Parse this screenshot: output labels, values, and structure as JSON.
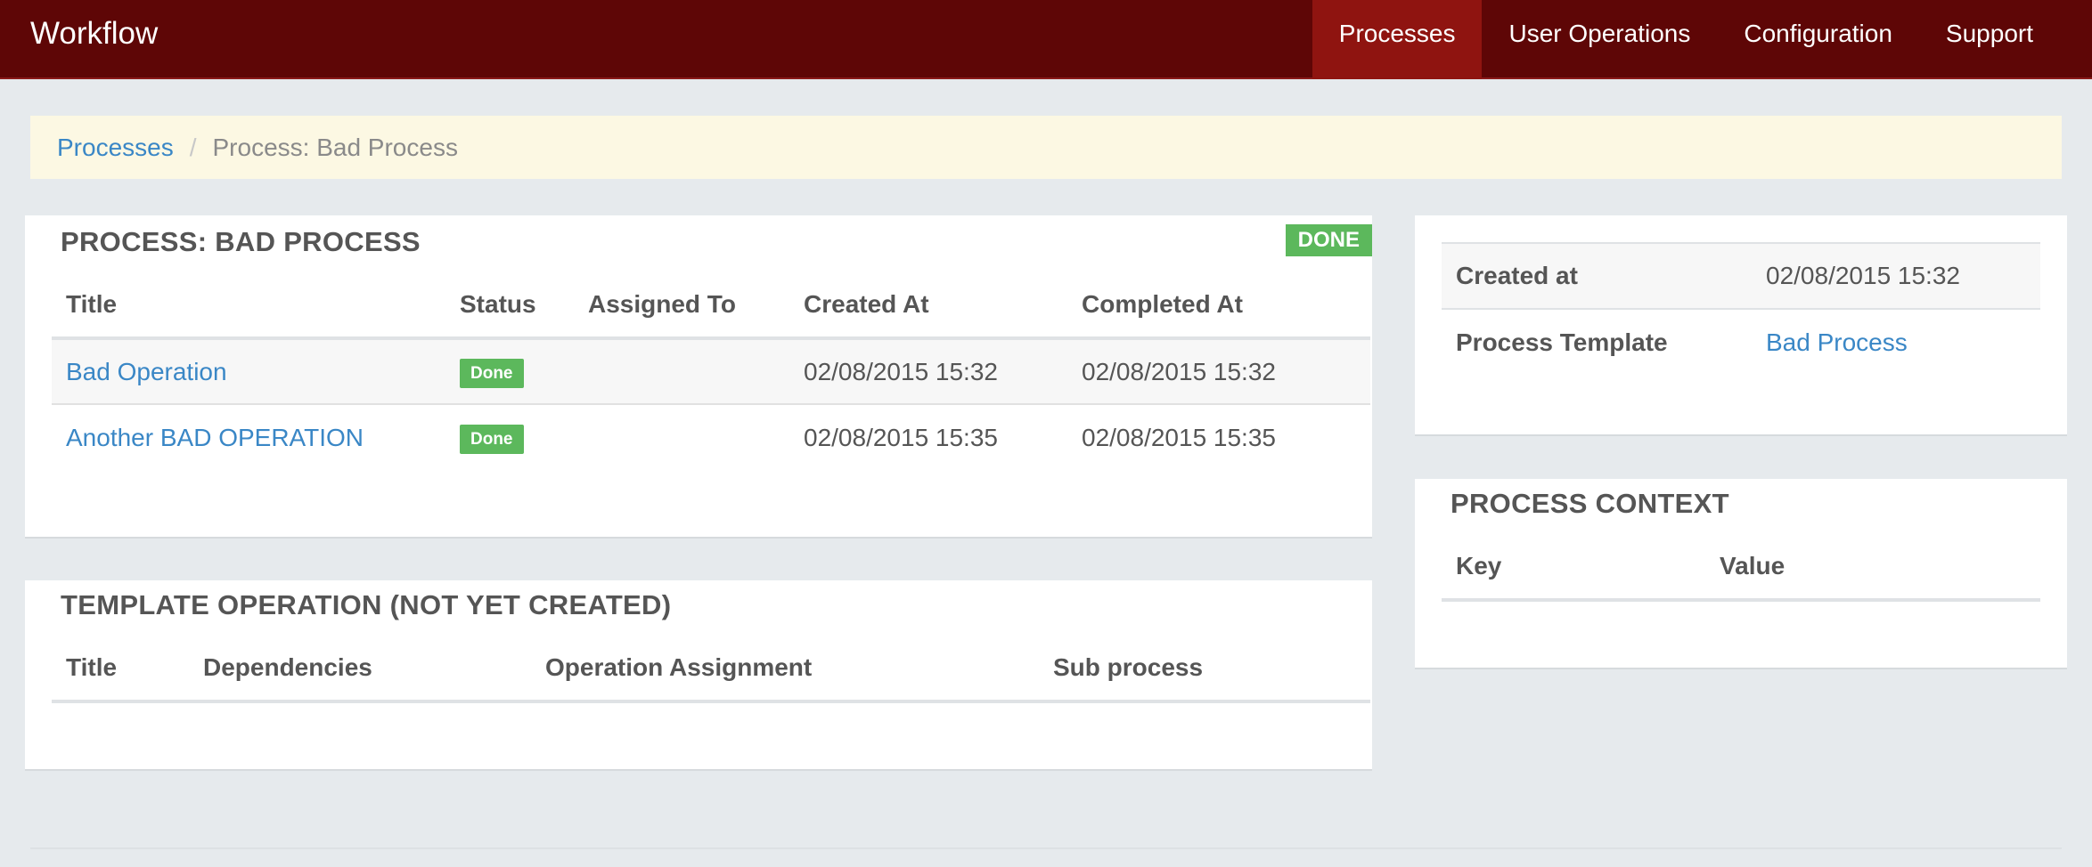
{
  "navbar": {
    "brand": "Workflow",
    "items": [
      {
        "label": "Processes",
        "active": true
      },
      {
        "label": "User Operations"
      },
      {
        "label": "Configuration"
      },
      {
        "label": "Support"
      }
    ]
  },
  "breadcrumb": {
    "link": "Processes",
    "separator": "/",
    "current": "Process: Bad Process"
  },
  "process_panel": {
    "title": "PROCESS: BAD PROCESS",
    "status_badge": "DONE",
    "columns": [
      "Title",
      "Status",
      "Assigned To",
      "Created At",
      "Completed At"
    ],
    "rows": [
      {
        "title": "Bad Operation",
        "status": "Done",
        "assigned_to": "",
        "created_at": "02/08/2015 15:32",
        "completed_at": "02/08/2015 15:32"
      },
      {
        "title": "Another BAD OPERATION",
        "status": "Done",
        "assigned_to": "",
        "created_at": "02/08/2015 15:35",
        "completed_at": "02/08/2015 15:35"
      }
    ]
  },
  "template_panel": {
    "title": "TEMPLATE OPERATION (NOT YET CREATED)",
    "columns": [
      "Title",
      "Dependencies",
      "Operation Assignment",
      "Sub process"
    ]
  },
  "info_panel": {
    "rows": [
      {
        "key": "Created at",
        "value": "02/08/2015 15:32",
        "link": false
      },
      {
        "key": "Process Template",
        "value": "Bad Process",
        "link": true
      }
    ]
  },
  "context_panel": {
    "title": "PROCESS CONTEXT",
    "columns": [
      "Key",
      "Value"
    ]
  },
  "colors": {
    "navbar": "#5e0606",
    "nav_active": "#8f1410",
    "link": "#3a87c6",
    "success": "#5cb85c",
    "breadcrumb_bg": "#fcf8e3"
  }
}
